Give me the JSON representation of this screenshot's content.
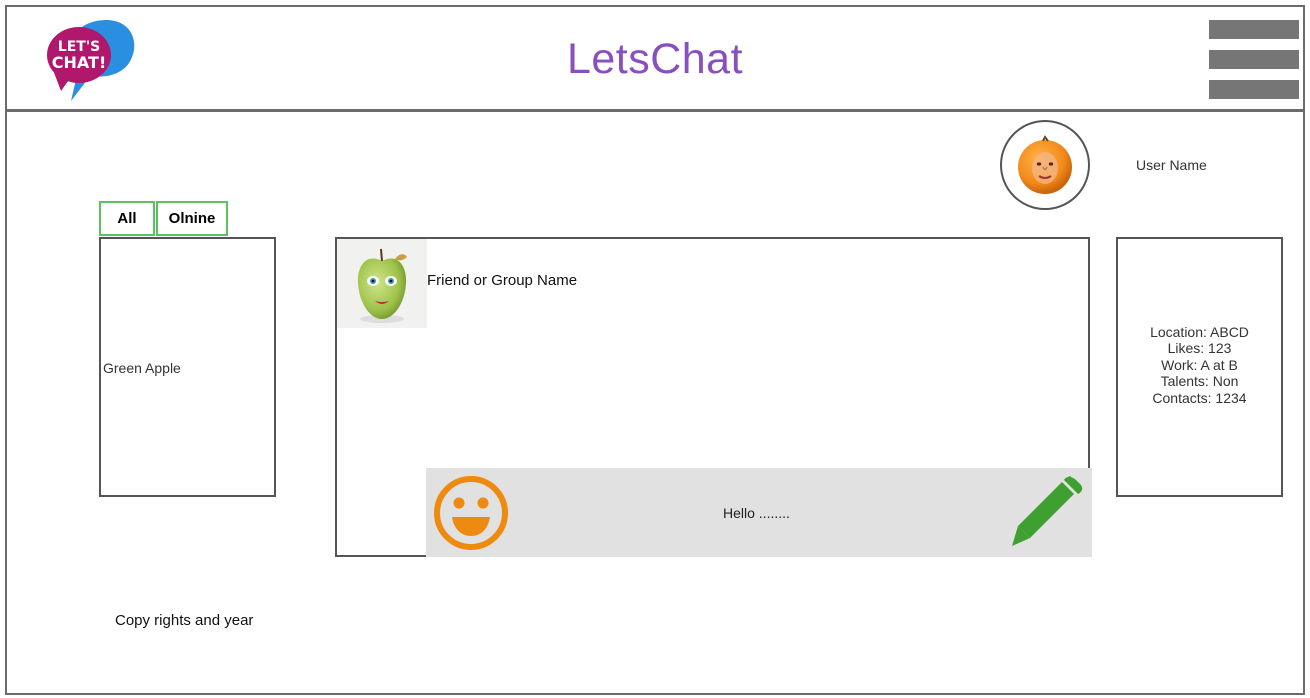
{
  "header": {
    "logo_text_line1": "LET'S",
    "logo_text_line2": "CHAT!",
    "title": "LetsChat",
    "menu_icon": "hamburger-menu-icon"
  },
  "user": {
    "name": "User Name",
    "avatar_icon": "orange-face-avatar"
  },
  "tabs": [
    {
      "label": "All"
    },
    {
      "label": "Olnine"
    }
  ],
  "friends": {
    "items": [
      {
        "name": "Green Apple"
      }
    ]
  },
  "chat": {
    "name": "Friend or Group Name",
    "avatar_icon": "green-apple-face-avatar",
    "compose": {
      "message": "Hello ........",
      "emoji_icon": "smiley-icon",
      "send_icon": "pencil-icon"
    }
  },
  "profile": {
    "lines": [
      "Location: ABCD",
      "Likes: 123",
      "Work: A at B",
      "Talents: Non",
      "Contacts: 1234"
    ]
  },
  "footer": {
    "text": "Copy rights and year"
  },
  "colors": {
    "title": "#8a4fbf",
    "tab_border": "#5ec15e",
    "emoji": "#ef8a10",
    "pencil": "#3ea030",
    "menu": "#767676",
    "compose_bg": "#e1e1e1"
  }
}
